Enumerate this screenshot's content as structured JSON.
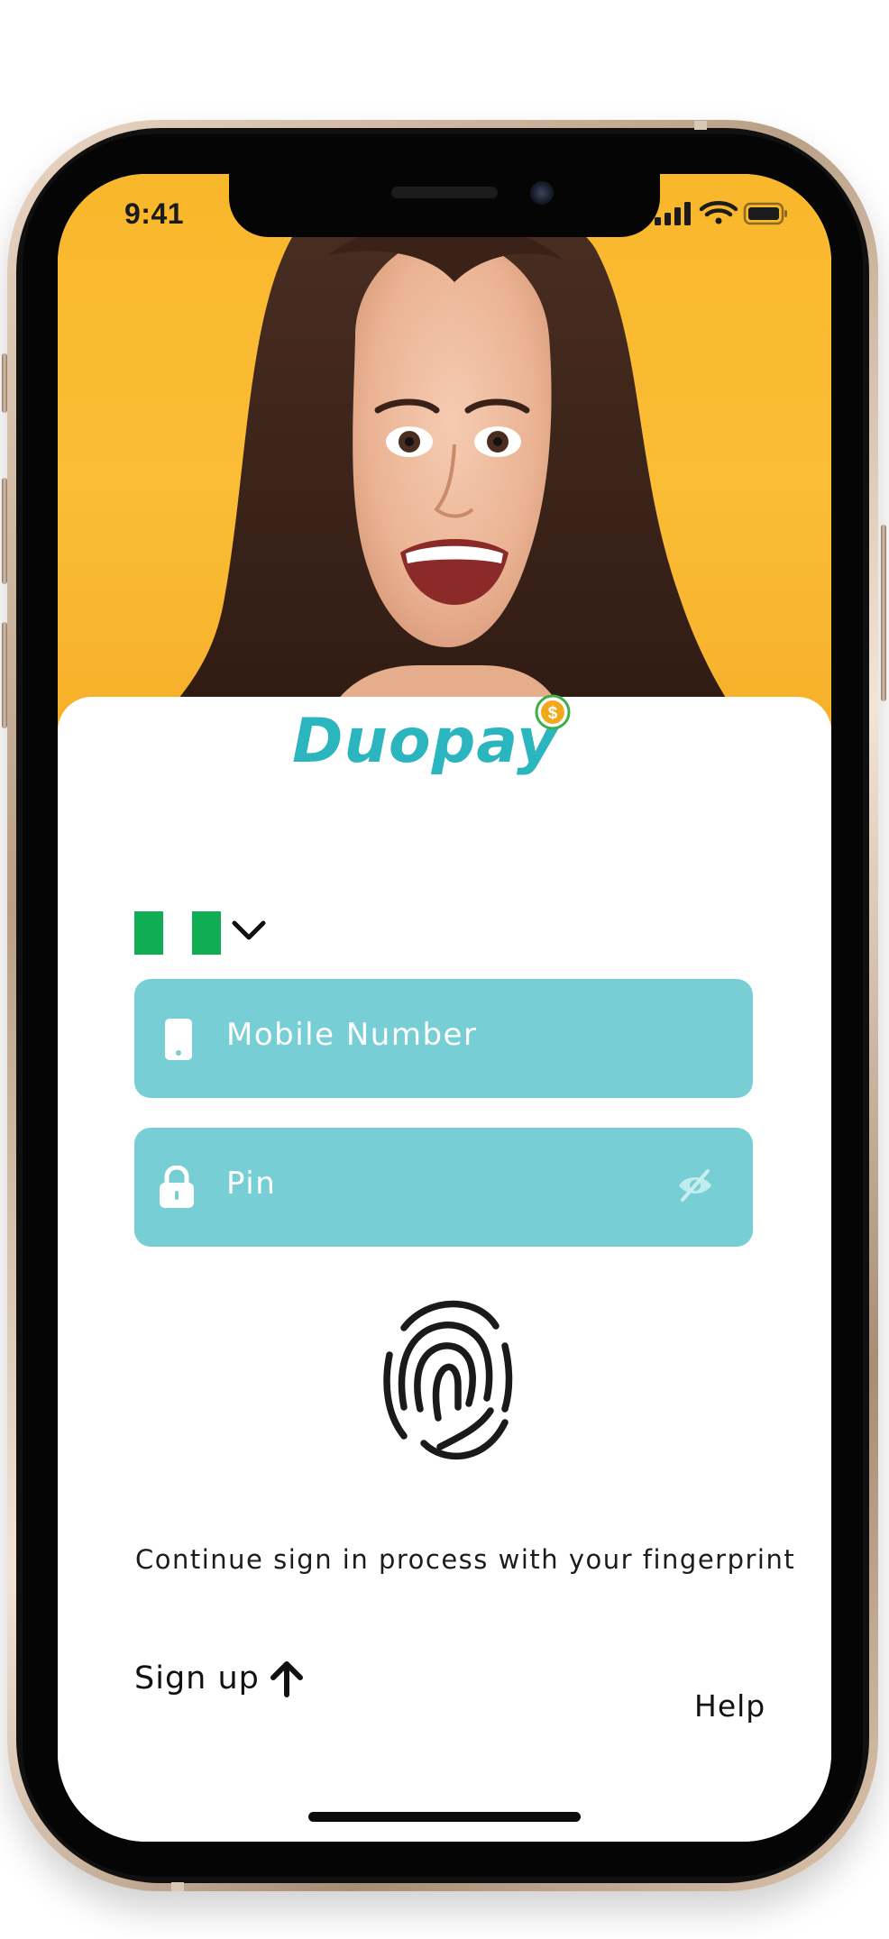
{
  "status_bar": {
    "time": "9:41"
  },
  "brand": {
    "name": "Duopay",
    "accent_color": "#2ab5bf",
    "coin_color": "#f0a81c",
    "coin_ring_color": "#3fae49",
    "coin_symbol": "$"
  },
  "hero": {
    "background_color": "#fbbd36",
    "subject": "smiling-woman-photo"
  },
  "country_selector": {
    "flag": "nigeria-flag",
    "flag_colors": [
      "#0fae55",
      "#ffffff",
      "#0fae55"
    ],
    "icon": "chevron-down-icon"
  },
  "form": {
    "mobile": {
      "placeholder": "Mobile Number",
      "icon": "phone-icon"
    },
    "pin": {
      "placeholder": "Pin",
      "icon": "lock-icon",
      "toggle_icon": "eye-off-icon"
    },
    "field_color": "#77cfd5"
  },
  "fingerprint": {
    "icon": "fingerprint-icon",
    "hint": "Continue sign in process with your fingerprint"
  },
  "footer": {
    "signup_label": "Sign up",
    "signup_icon": "arrow-up-icon",
    "help_label": "Help"
  }
}
